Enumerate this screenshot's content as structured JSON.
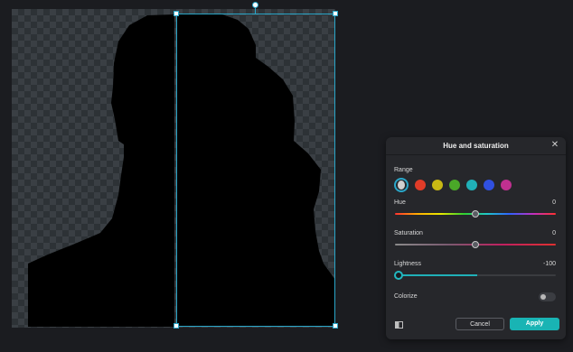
{
  "panel": {
    "title": "Hue and saturation",
    "close_icon": "close-icon",
    "range_label": "Range",
    "swatches": [
      {
        "name": "all",
        "color": "#d0d0d0",
        "selected": true
      },
      {
        "name": "red",
        "color": "#e03c28"
      },
      {
        "name": "yellow",
        "color": "#c8b814"
      },
      {
        "name": "green",
        "color": "#4aa828"
      },
      {
        "name": "cyan",
        "color": "#20b0b8"
      },
      {
        "name": "blue",
        "color": "#3050e0"
      },
      {
        "name": "magenta",
        "color": "#c03090"
      }
    ],
    "hue": {
      "label": "Hue",
      "value": "0",
      "fraction": 0.5
    },
    "saturation": {
      "label": "Saturation",
      "value": "0",
      "fraction": 0.5
    },
    "lightness": {
      "label": "Lightness",
      "value": "-100",
      "fraction": 0.0
    },
    "colorize": {
      "label": "Colorize",
      "enabled": false
    },
    "cancel_label": "Cancel",
    "apply_label": "Apply",
    "compare_icon": "compare-icon"
  },
  "colors": {
    "accent": "#19b4b4",
    "selection": "#2aa6c8",
    "background": "#1b1c20",
    "panel": "#26272b"
  }
}
